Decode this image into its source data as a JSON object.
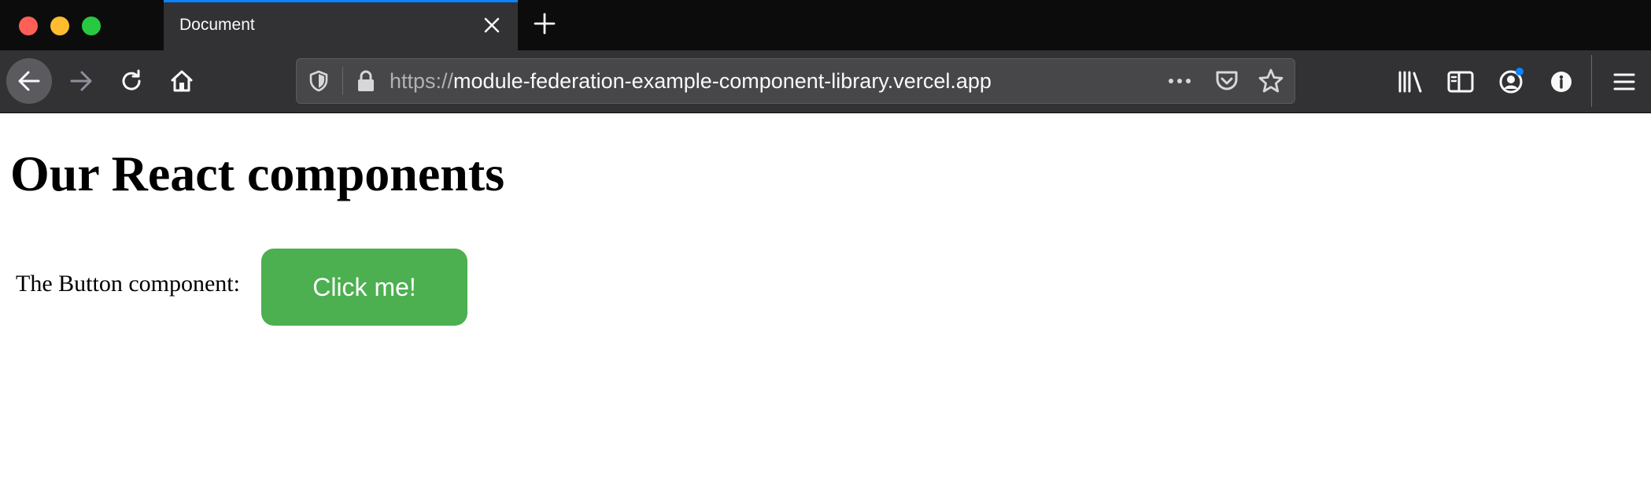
{
  "browser": {
    "tab": {
      "title": "Document"
    },
    "urlbar": {
      "scheme": "https://",
      "host": "module-federation-example-component-library.vercel.app"
    },
    "colors": {
      "tab_accent": "#0a84ff",
      "account_badge": "#0a84ff"
    },
    "icons": {
      "tab_close": "close-icon",
      "new_tab": "plus-icon",
      "back": "arrow-left-icon",
      "forward": "arrow-right-icon",
      "reload": "reload-icon",
      "home": "home-icon",
      "tracking": "shield-icon",
      "secure": "lock-icon",
      "page_actions": "more-icon",
      "pocket": "pocket-icon",
      "bookmark": "star-icon",
      "library": "library-icon",
      "sidebar": "sidebar-icon",
      "account": "account-icon",
      "extension": "info-icon",
      "menu": "hamburger-menu-icon"
    }
  },
  "page": {
    "heading": "Our React components",
    "button_section_label": "The Button component:",
    "button_label": "Click me!",
    "button_color": "#4caf50"
  }
}
